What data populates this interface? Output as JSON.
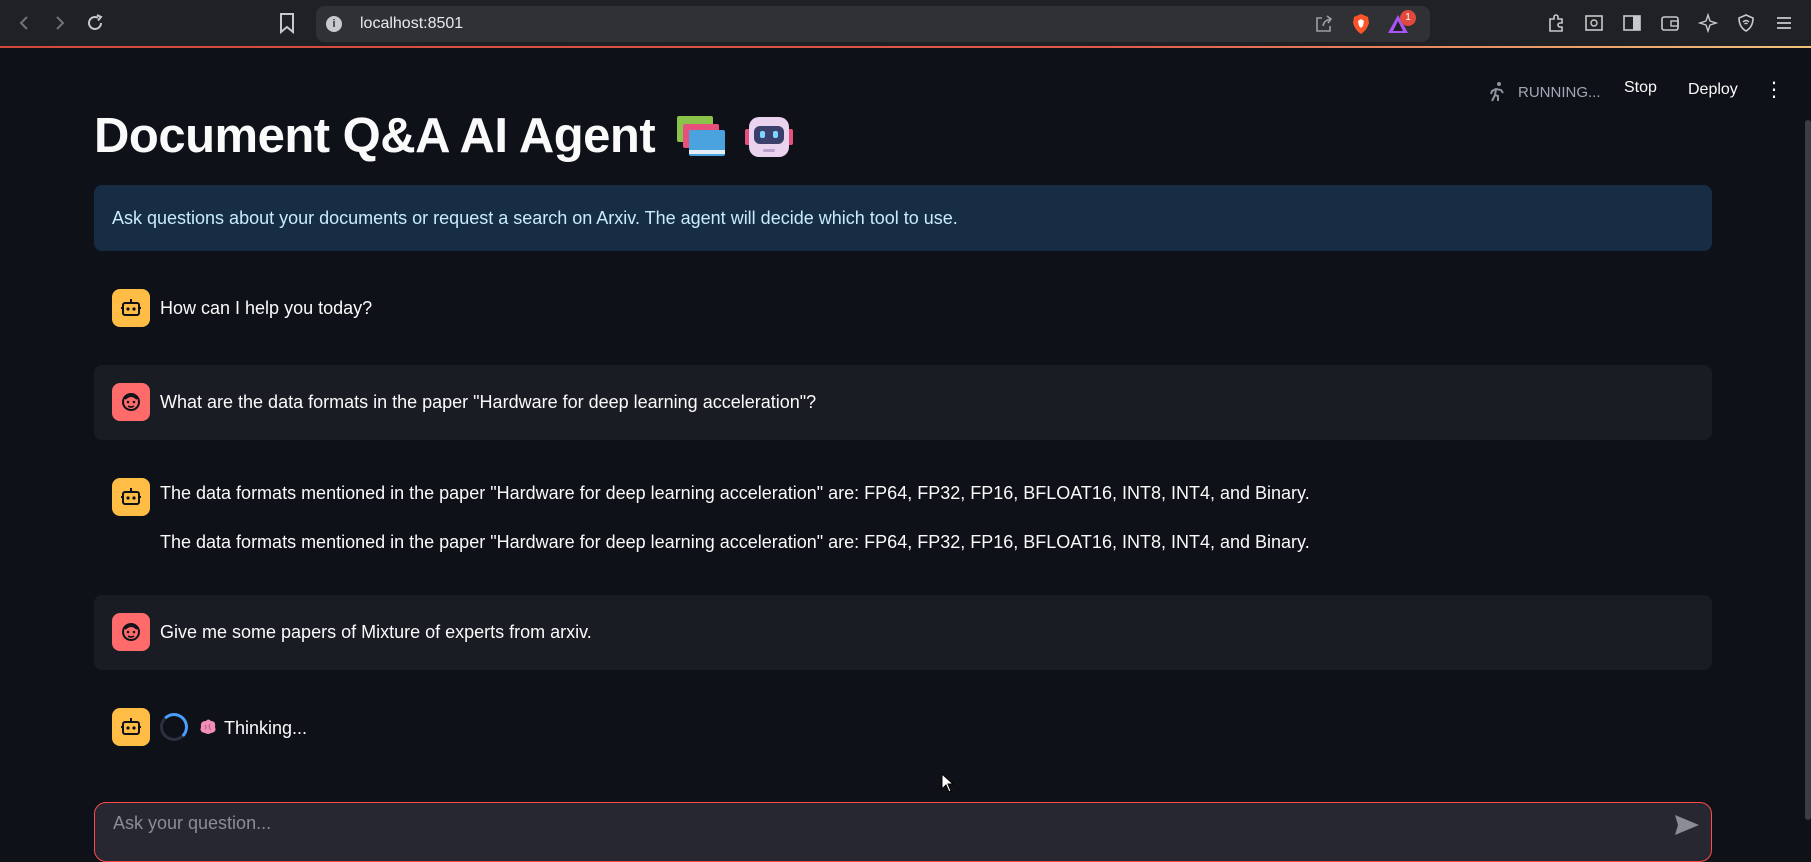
{
  "browser": {
    "url": "localhost:8501",
    "rewards_badge": "1"
  },
  "header": {
    "status": "RUNNING...",
    "stop_label": "Stop",
    "deploy_label": "Deploy",
    "menu_glyph": "⋮"
  },
  "page": {
    "title": "Document Q&A AI Agent",
    "info": "Ask questions about your documents or request a search on Arxiv. The agent will decide which tool to use."
  },
  "messages": [
    {
      "role": "assistant",
      "text": "How can I help you today?"
    },
    {
      "role": "user",
      "text": "What are the data formats in the paper \"Hardware for deep learning acceleration\"?"
    },
    {
      "role": "assistant",
      "text": "The data formats mentioned in the paper \"Hardware for deep learning acceleration\" are: FP64, FP32, FP16, BFLOAT16, INT8, INT4, and Binary.",
      "text2": "The data formats mentioned in the paper \"Hardware for deep learning acceleration\" are: FP64, FP32, FP16, BFLOAT16, INT8, INT4, and Binary."
    },
    {
      "role": "user",
      "text": "Give me some papers of Mixture of experts from arxiv."
    },
    {
      "role": "assistant",
      "status": "Thinking..."
    }
  ],
  "chat_input": {
    "placeholder": "Ask your question..."
  },
  "colors": {
    "background": "#0e1117",
    "info_bg": "#172d43",
    "bot_avatar": "#ffbd45",
    "user_avatar": "#ff6b6b",
    "accent": "#ff4b4b"
  }
}
